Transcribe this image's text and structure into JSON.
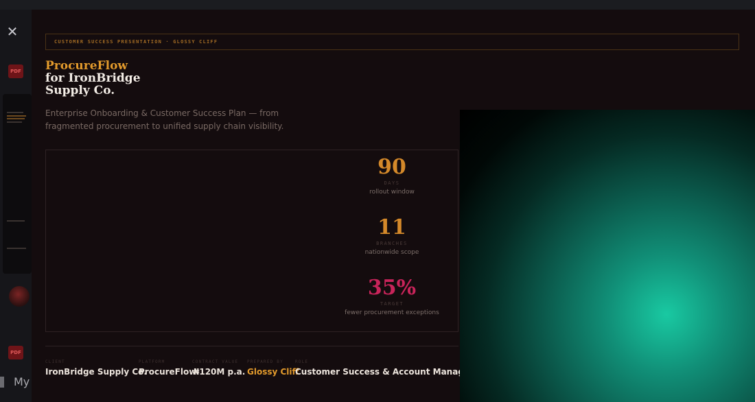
{
  "viewer": {
    "close_icon": "close-icon",
    "pdf_badge": "PDF",
    "my_label": "My"
  },
  "slide": {
    "kicker": "CUSTOMER SUCCESS PRESENTATION · GLOSSY CLIFF",
    "title_accent": "ProcureFlow",
    "title_line1": "for IronBridge",
    "title_line2": "Supply Co.",
    "subtitle": "Enterprise Onboarding & Customer Success Plan — from fragmented procurement to unified supply chain visibility.",
    "stats": [
      {
        "number": "90",
        "unit": "DAYS",
        "desc": "rollout window"
      },
      {
        "number": "11",
        "unit": "BRANCHES",
        "desc": "nationwide scope"
      },
      {
        "number": "35%",
        "unit": "TARGET",
        "desc": "fewer procurement exceptions"
      }
    ],
    "meta": {
      "client_label": "CLIENT",
      "client_value": "IronBridge Supply Co.",
      "platform_label": "PLATFORM",
      "platform_value": "ProcureFlow",
      "contract_label": "CONTRACT VALUE",
      "contract_value": "₦120M p.a.",
      "prepared_label": "PREPARED BY",
      "prepared_value": "Glossy Cliff",
      "role_label": "ROLE",
      "role_value": "Customer Success & Account Manager"
    }
  },
  "colors": {
    "accent": "#e29a2c",
    "pink": "#c8245a",
    "background": "#140c0e"
  }
}
